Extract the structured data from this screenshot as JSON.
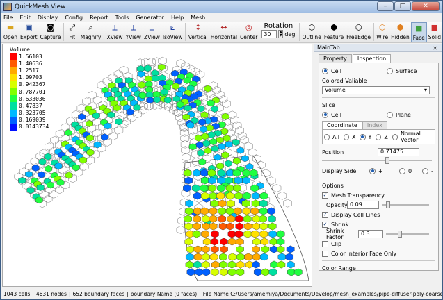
{
  "window": {
    "title": "QuickMesh View"
  },
  "menu": [
    "File",
    "Edit",
    "Display",
    "Config",
    "Report",
    "Tools",
    "Generator",
    "Help",
    "Mesh"
  ],
  "toolbar": {
    "buttons": [
      {
        "id": "open",
        "label": "Open",
        "icon": "folder-icon"
      },
      {
        "id": "export",
        "label": "Export",
        "icon": "save-icon"
      },
      {
        "id": "capture",
        "label": "Capture",
        "icon": "camera-icon"
      },
      {
        "id": "fit",
        "label": "Fit",
        "icon": "fit-icon"
      },
      {
        "id": "magnify",
        "label": "Magnify",
        "icon": "magnify-icon"
      },
      {
        "id": "xview",
        "label": "XView",
        "icon": "x-axis-icon"
      },
      {
        "id": "yview",
        "label": "YView",
        "icon": "y-axis-icon"
      },
      {
        "id": "zview",
        "label": "ZView",
        "icon": "z-axis-icon"
      },
      {
        "id": "isoview",
        "label": "IsoView",
        "icon": "iso-axis-icon"
      },
      {
        "id": "vertical",
        "label": "Vertical",
        "icon": "vertical-icon"
      },
      {
        "id": "horizontal",
        "label": "Horizontal",
        "icon": "horizontal-icon"
      },
      {
        "id": "center",
        "label": "Center",
        "icon": "target-icon"
      }
    ],
    "rotation_label": "Rotation",
    "rotation_value": "30",
    "rotation_unit": "deg",
    "display_buttons": [
      {
        "id": "outline",
        "label": "Outline",
        "icon": "outline-icon"
      },
      {
        "id": "feature",
        "label": "Feature",
        "icon": "feature-icon"
      },
      {
        "id": "freeedge",
        "label": "FreeEdge",
        "icon": "free-edge-icon"
      },
      {
        "id": "wire",
        "label": "Wire",
        "icon": "wire-icon"
      },
      {
        "id": "hidden",
        "label": "Hidden",
        "icon": "hidden-icon"
      },
      {
        "id": "face",
        "label": "Face",
        "icon": "face-icon",
        "active": true
      },
      {
        "id": "solid",
        "label": "Solid",
        "icon": "solid-icon"
      }
    ]
  },
  "legend": {
    "title": "Volume",
    "values": [
      "1.56103",
      "1.40636",
      "1.2517",
      "1.09703",
      "0.942367",
      "0.787701",
      "0.633036",
      "0.47837",
      "0.323705",
      "0.169039",
      "0.0143734"
    ],
    "colors": [
      "#ff0000",
      "#ff5a00",
      "#ffaa00",
      "#ffe000",
      "#d8ff00",
      "#80ff00",
      "#20ff40",
      "#00e0a0",
      "#00b8ff",
      "#0060ff",
      "#0010ff"
    ]
  },
  "panel": {
    "header": "MainTab",
    "close": "✕",
    "tabs": [
      "Property",
      "Inspection"
    ],
    "active_tab": "Inspection",
    "target_options": [
      "Cell",
      "Surface"
    ],
    "target_selected": "Cell",
    "colored_label": "Colored Valiable",
    "colored_value": "Volume",
    "slice_label": "Slice",
    "slice_options": [
      "Cell",
      "Plane"
    ],
    "slice_selected": "Cell",
    "inner_tabs": [
      "Coordinate",
      "Index"
    ],
    "axis_options": [
      "All",
      "X",
      "Y",
      "Z",
      "Normal Vector"
    ],
    "axis_selected": "Y",
    "position_label": "Position",
    "position_value": "0.71475",
    "position_slider": 0.6,
    "display_side_label": "Display Side",
    "display_side_options": [
      "+",
      "0",
      "-"
    ],
    "display_side_selected": "+",
    "options_label": "Options",
    "mesh_transparency_label": "Mesh Transparency",
    "mesh_transparency": true,
    "opacity_label": "Opacity",
    "opacity_value": "0.09",
    "opacity_slider": 0.09,
    "display_cell_lines_label": "Display Cell Lines",
    "display_cell_lines": true,
    "shrink_label": "Shrink",
    "shrink": true,
    "shrink_factor_label": "Shrink Factor",
    "shrink_factor_value": "0.3",
    "shrink_slider": 0.3,
    "clip_label": "Clip",
    "clip": false,
    "color_interior_label": "Color Interior Face Only",
    "color_interior": false,
    "color_range_label": "Color Range"
  },
  "status": {
    "cells": "1043 cells",
    "nodes": "4631 nodes",
    "boundary_faces": "652 boundary faces",
    "boundary_name": "boundary Name  (0 faces)",
    "file_name": "File Name C:/Users/amemiya/Documents/Develop/mesh_examples/pipe-diffuser-poly-coarse.cas"
  }
}
